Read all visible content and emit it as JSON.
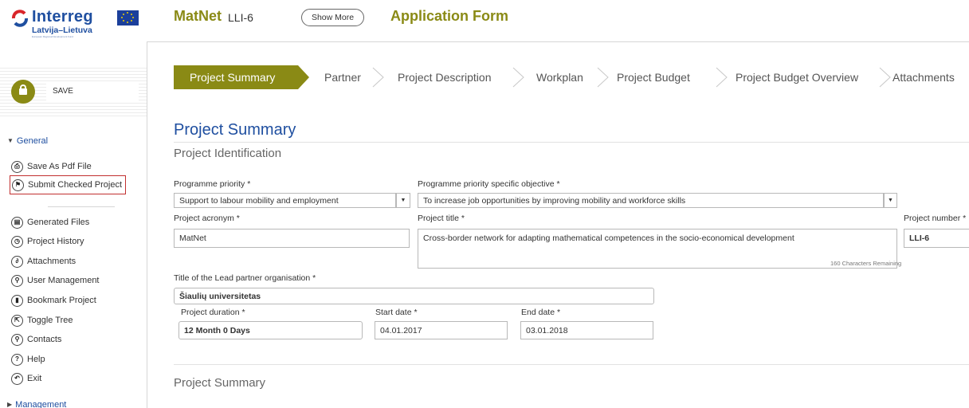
{
  "header": {
    "logo_text": "Interreg",
    "logo_subtext": "Latvija–Lietuva",
    "logo_fineprint": "European Regional Development Fund",
    "app_name": "MatNet",
    "project_code": "LLI-6",
    "show_more_label": "Show More",
    "form_title": "Application Form"
  },
  "sidebar": {
    "save_label": "SAVE",
    "general_label": "General",
    "management_label": "Management",
    "items": [
      {
        "label": "Save As Pdf File",
        "icon": "printer-icon"
      },
      {
        "label": "Submit Checked Project",
        "icon": "flag-icon"
      },
      {
        "label": "Generated Files",
        "icon": "files-icon"
      },
      {
        "label": "Project History",
        "icon": "history-icon"
      },
      {
        "label": "Attachments",
        "icon": "paperclip-icon"
      },
      {
        "label": "User Management",
        "icon": "user-icon"
      },
      {
        "label": "Bookmark Project",
        "icon": "bookmark-icon"
      },
      {
        "label": "Toggle Tree",
        "icon": "toggle-tree-icon"
      },
      {
        "label": "Contacts",
        "icon": "contacts-icon"
      },
      {
        "label": "Help",
        "icon": "help-icon"
      },
      {
        "label": "Exit",
        "icon": "exit-icon"
      }
    ]
  },
  "tabs": [
    {
      "label": "Project Summary",
      "active": true
    },
    {
      "label": "Partner"
    },
    {
      "label": "Project Description"
    },
    {
      "label": "Workplan"
    },
    {
      "label": "Project Budget"
    },
    {
      "label": "Project Budget Overview"
    },
    {
      "label": "Attachments"
    }
  ],
  "main": {
    "title": "Project Summary",
    "section_identification": "Project Identification",
    "section_summary": "Project Summary",
    "fields": {
      "programme_priority": {
        "label": "Programme priority *",
        "value": "Support to labour mobility and employment"
      },
      "specific_objective": {
        "label": "Programme priority specific objective *",
        "value": "To increase job opportunities by improving mobility and workforce skills"
      },
      "acronym": {
        "label": "Project acronym *",
        "value": "MatNet"
      },
      "title": {
        "label": "Project title *",
        "value": "Cross-border network for adapting mathematical competences in the socio-economical development",
        "remaining": "160 Characters Remaining"
      },
      "number": {
        "label": "Project number *",
        "value": "LLI-6"
      },
      "lead_partner": {
        "label": "Title of the Lead partner organisation *",
        "value": "Šiaulių universitetas"
      },
      "duration": {
        "label": "Project duration *",
        "value": "12 Month 0 Days"
      },
      "start_date": {
        "label": "Start date *",
        "value": "04.01.2017"
      },
      "end_date": {
        "label": "End date *",
        "value": "03.01.2018"
      }
    }
  },
  "colors": {
    "accent": "#8a8a15",
    "brand_blue": "#1f4fa0",
    "highlight_border": "#c23030"
  }
}
